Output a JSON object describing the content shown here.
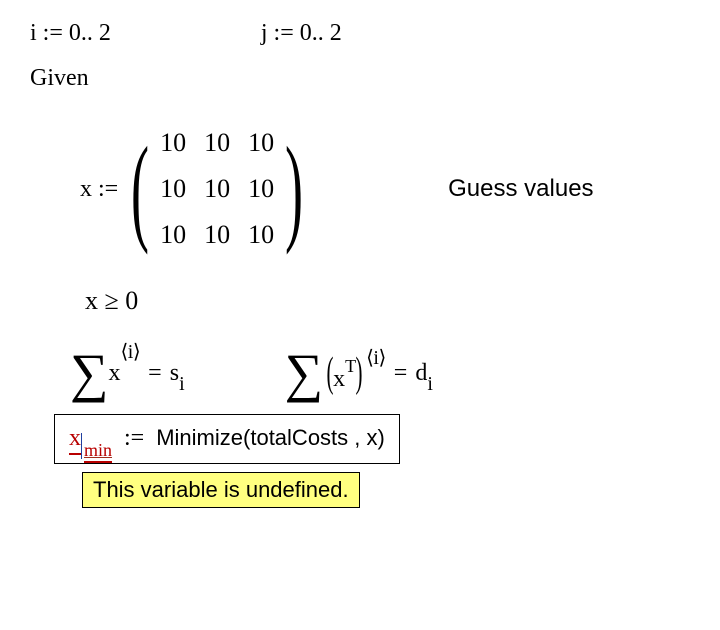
{
  "range_i": {
    "var": "i",
    "assign": ":=",
    "value": "0.. 2"
  },
  "range_j": {
    "var": "j",
    "assign": ":=",
    "value": "0.. 2"
  },
  "given": "Given",
  "x_assign": {
    "var": "x",
    "assign": ":="
  },
  "matrix": {
    "r0c0": "10",
    "r0c1": "10",
    "r0c2": "10",
    "r1c0": "10",
    "r1c1": "10",
    "r1c2": "10",
    "r2c0": "10",
    "r2c1": "10",
    "r2c2": "10"
  },
  "guess_label": "Guess values",
  "constraint": {
    "lhs": "x",
    "op": "≥",
    "rhs": "0"
  },
  "sum1": {
    "base": "x",
    "sup": "⟨i⟩",
    "eq": "=",
    "rhs_base": "s",
    "rhs_sub": "i"
  },
  "sum2": {
    "inner_base": "x",
    "inner_sup": "T",
    "outer_sup": "⟨i⟩",
    "eq": "=",
    "rhs_base": "d",
    "rhs_sub": "i"
  },
  "minimize": {
    "var": "x",
    "sub": "min",
    "assign": ":=",
    "func": "Minimize",
    "args": "totalCosts , x"
  },
  "tooltip": "This variable is undefined."
}
